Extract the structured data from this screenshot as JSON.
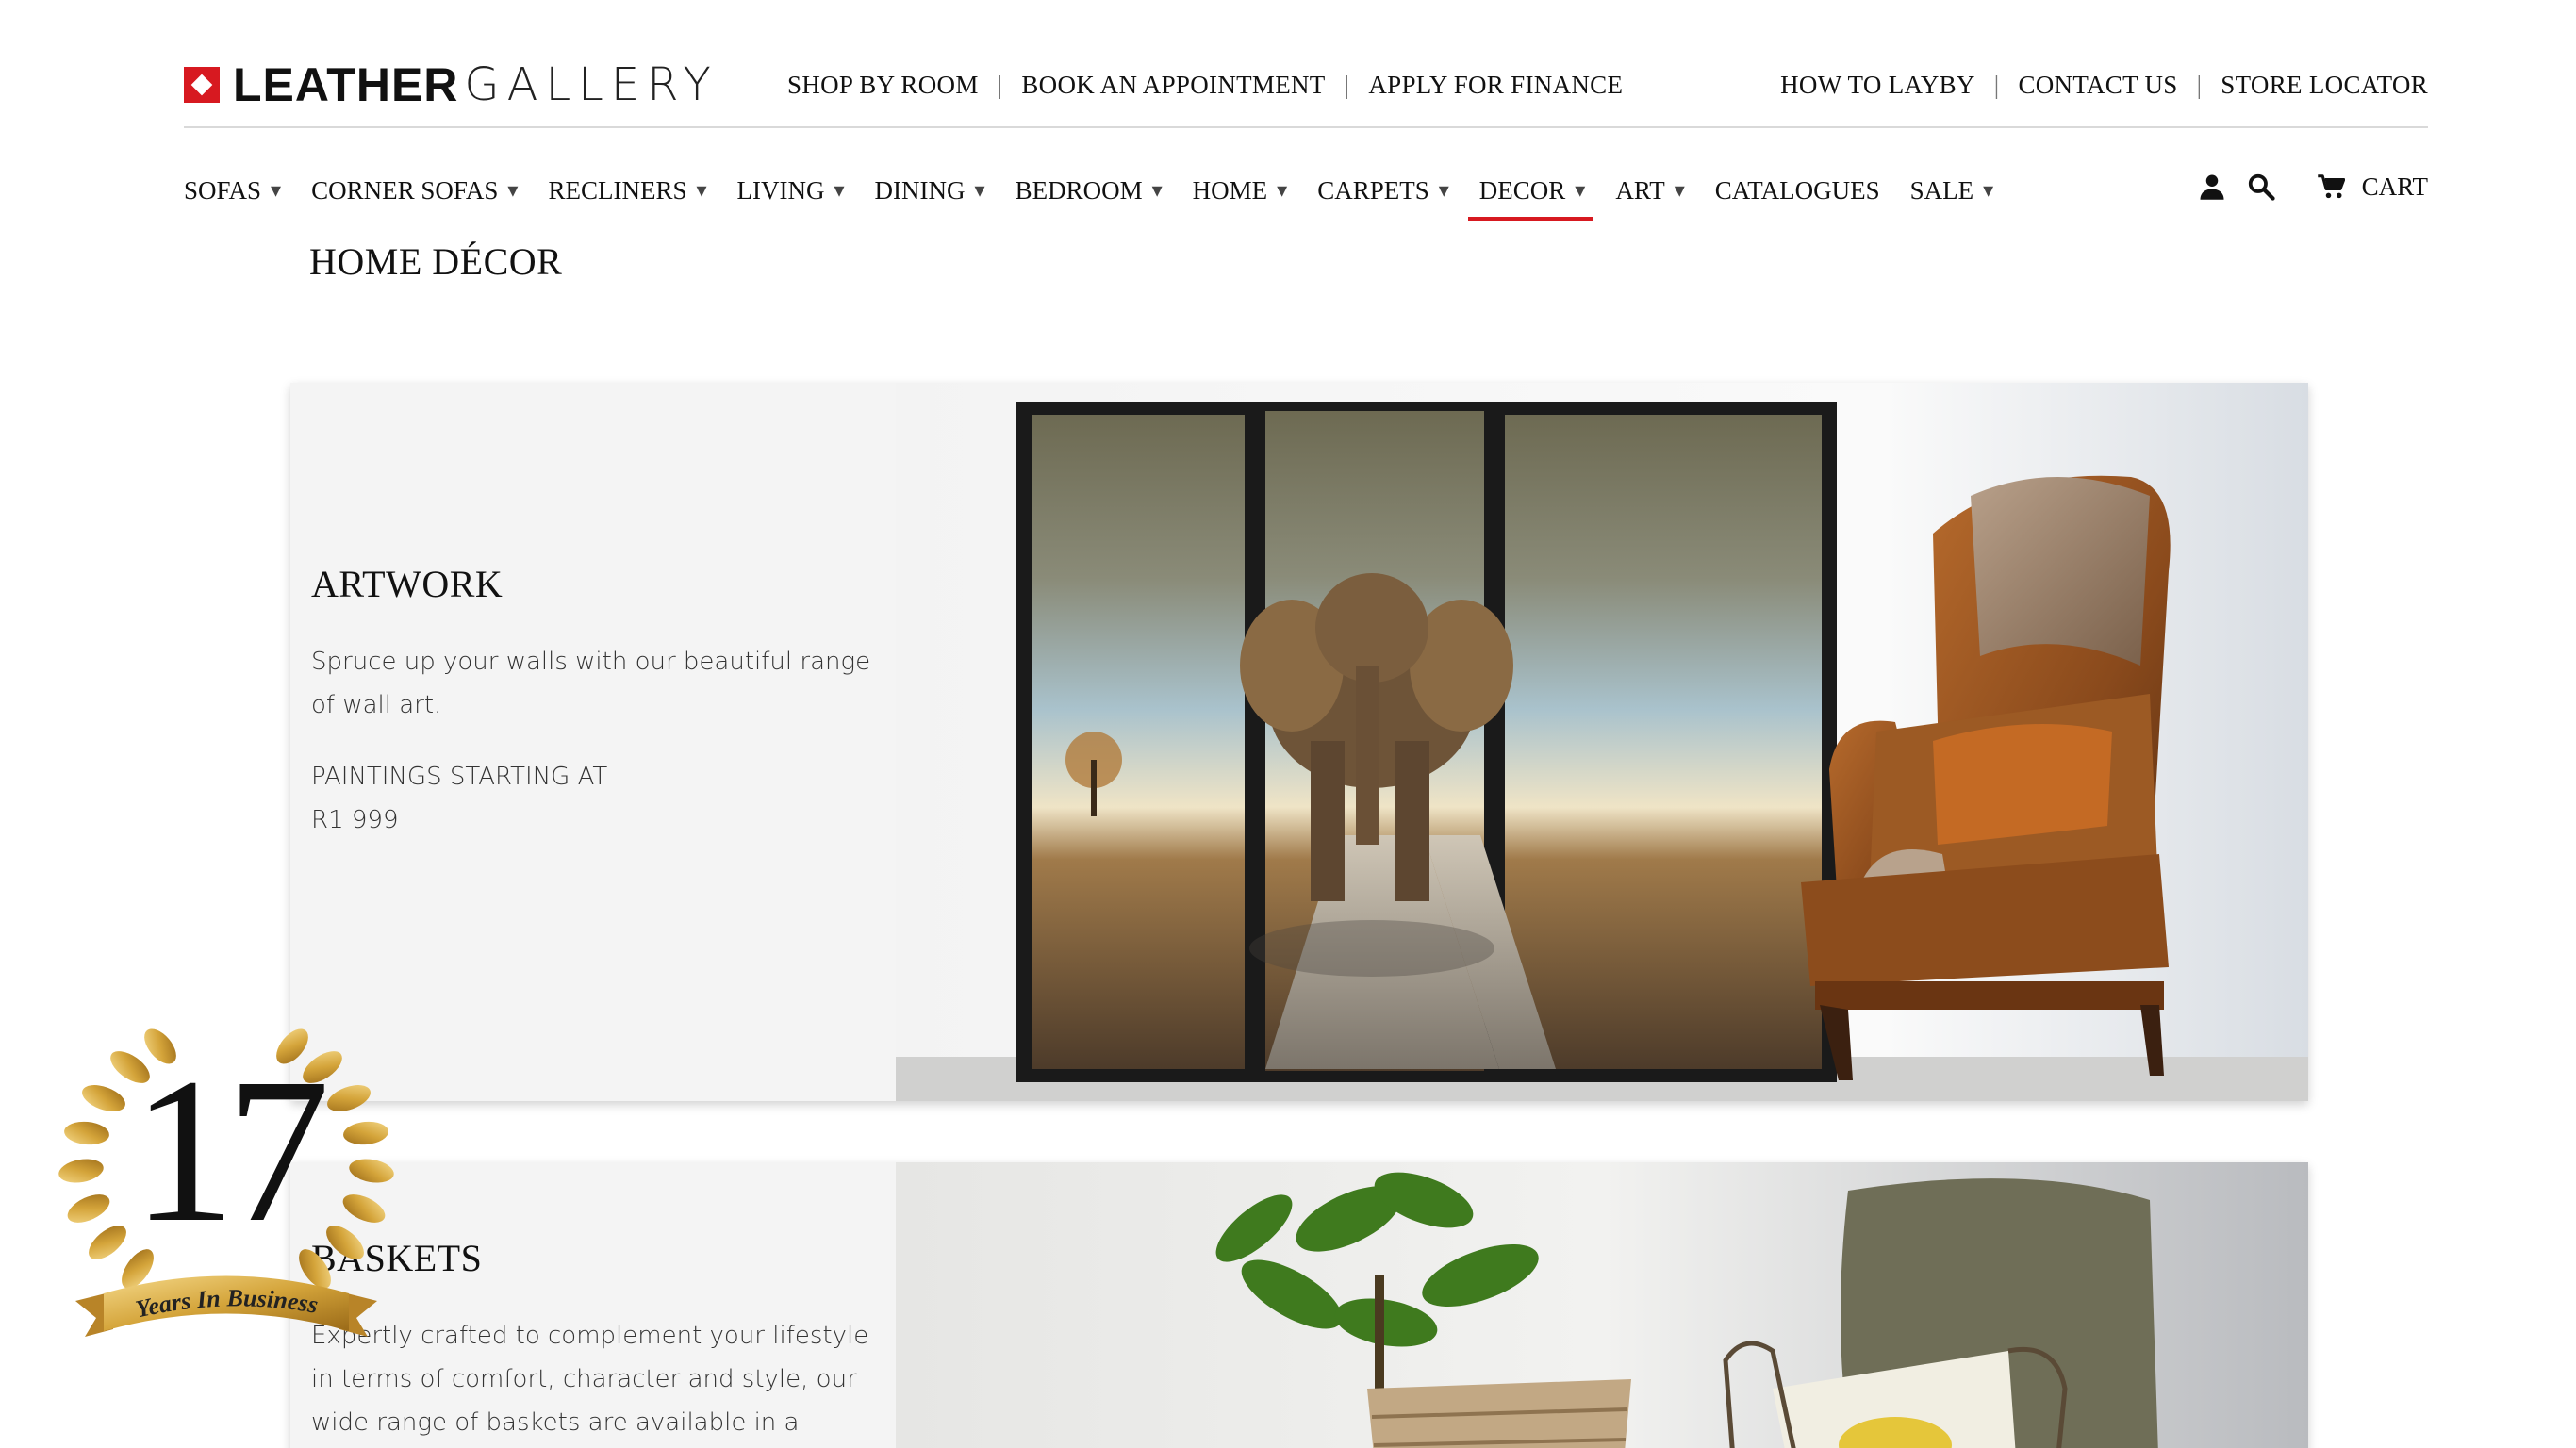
{
  "brand": {
    "bold": "LEATHER",
    "light": "GALLERY",
    "accent": "#d71920"
  },
  "util_nav_left": [
    {
      "label": "SHOP BY ROOM"
    },
    {
      "label": "BOOK AN APPOINTMENT"
    },
    {
      "label": "APPLY FOR FINANCE"
    }
  ],
  "util_nav_right": [
    {
      "label": "HOW TO LAYBY"
    },
    {
      "label": "CONTACT US"
    },
    {
      "label": "STORE LOCATOR"
    }
  ],
  "separator": "|",
  "main_nav": [
    {
      "label": "SOFAS",
      "arrow": "▾"
    },
    {
      "label": "CORNER SOFAS",
      "arrow": "▾"
    },
    {
      "label": "RECLINERS",
      "arrow": "▾"
    },
    {
      "label": "LIVING",
      "arrow": "▾"
    },
    {
      "label": "DINING",
      "arrow": "▾"
    },
    {
      "label": "BEDROOM",
      "arrow": "▾"
    },
    {
      "label": "HOME",
      "arrow": "▾"
    },
    {
      "label": "CARPETS",
      "arrow": "▾"
    },
    {
      "label": "DECOR",
      "arrow": "▾",
      "active": true
    },
    {
      "label": "ART",
      "arrow": "▾"
    },
    {
      "label": "CATALOGUES",
      "arrow": ""
    },
    {
      "label": "SALE",
      "arrow": "▾"
    }
  ],
  "tools": {
    "account_icon": "user-icon",
    "search_icon": "search-icon",
    "cart_icon": "cart-icon",
    "cart_label": "CART"
  },
  "page": {
    "title": "HOME DÉCOR"
  },
  "categories": [
    {
      "title": "ARTWORK",
      "desc": "Spruce up your walls with our beautiful range of wall art.",
      "price_line1": "PAINTINGS STARTING AT",
      "price_line2": "R1 999"
    },
    {
      "title": "BASKETS",
      "desc": "Expertly crafted to complement your lifestyle in terms of comfort, character and style, our wide range of baskets are available in a various"
    }
  ],
  "badge": {
    "number": "17",
    "ribbon": "Years In Business"
  }
}
